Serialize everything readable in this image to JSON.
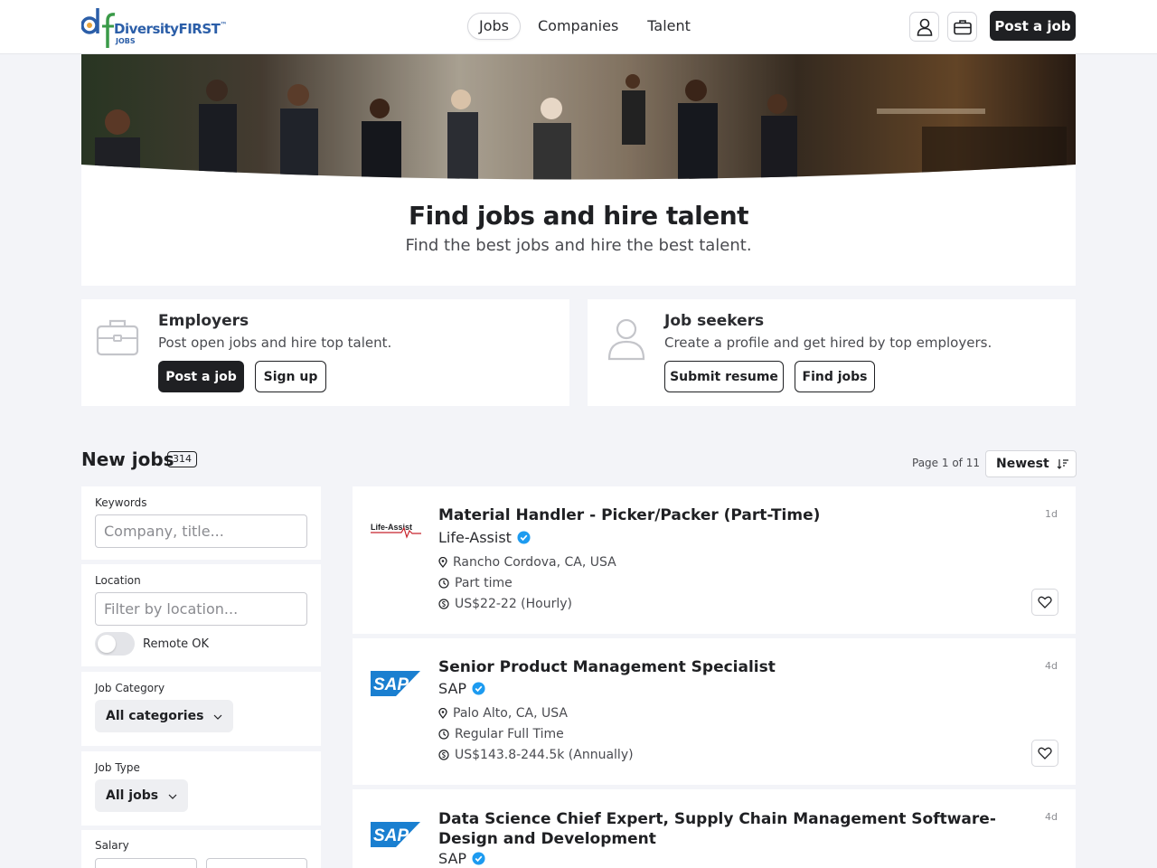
{
  "header": {
    "brand": "DiversityFIRST",
    "brand_tm": "™",
    "brand_sub": "JOBS",
    "nav": [
      {
        "label": "Jobs",
        "active": true
      },
      {
        "label": "Companies",
        "active": false
      },
      {
        "label": "Talent",
        "active": false
      }
    ],
    "post_job_label": "Post a job"
  },
  "hero": {
    "title": "Find jobs and hire talent",
    "subtitle": "Find the best jobs and hire the best talent."
  },
  "employers": {
    "title": "Employers",
    "text": "Post open jobs and hire top talent.",
    "primary": "Post a job",
    "secondary": "Sign up"
  },
  "seekers": {
    "title": "Job seekers",
    "text": "Create a profile and get hired by top employers.",
    "primary": "Submit resume",
    "secondary": "Find jobs"
  },
  "jobs": {
    "title": "New jobs",
    "count": "314",
    "page_info": "Page 1 of 11",
    "sort_label": "Newest"
  },
  "filters": {
    "keywords_label": "Keywords",
    "keywords_placeholder": "Company, title...",
    "location_label": "Location",
    "location_placeholder": "Filter by location...",
    "remote_label": "Remote OK",
    "remote_on": false,
    "category_label": "Job Category",
    "category_value": "All categories",
    "type_label": "Job Type",
    "type_value": "All jobs",
    "salary_label": "Salary"
  },
  "job_list": [
    {
      "title": "Material Handler - Picker/Packer (Part-Time)",
      "company": "Life-Assist",
      "logo_text": "Life-Assist",
      "location": "Rancho Cordova, CA, USA",
      "type": "Part time",
      "salary": "US$22-22 (Hourly)",
      "age": "1d"
    },
    {
      "title": "Senior Product Management Specialist",
      "company": "SAP",
      "logo_text": "SAP",
      "location": "Palo Alto, CA, USA",
      "type": "Regular Full Time",
      "salary": "US$143.8-244.5k (Annually)",
      "age": "4d"
    },
    {
      "title": "Data Science Chief Expert, Supply Chain Management Software-Design and Development",
      "company": "SAP",
      "logo_text": "SAP",
      "age": "4d"
    }
  ],
  "colors": {
    "accent_dark": "#1f2023",
    "verified": "#1d9bf0",
    "brand_blue": "#2b5ea8",
    "brand_green": "#3a9a48",
    "sap_blue": "#1a7fd0"
  }
}
